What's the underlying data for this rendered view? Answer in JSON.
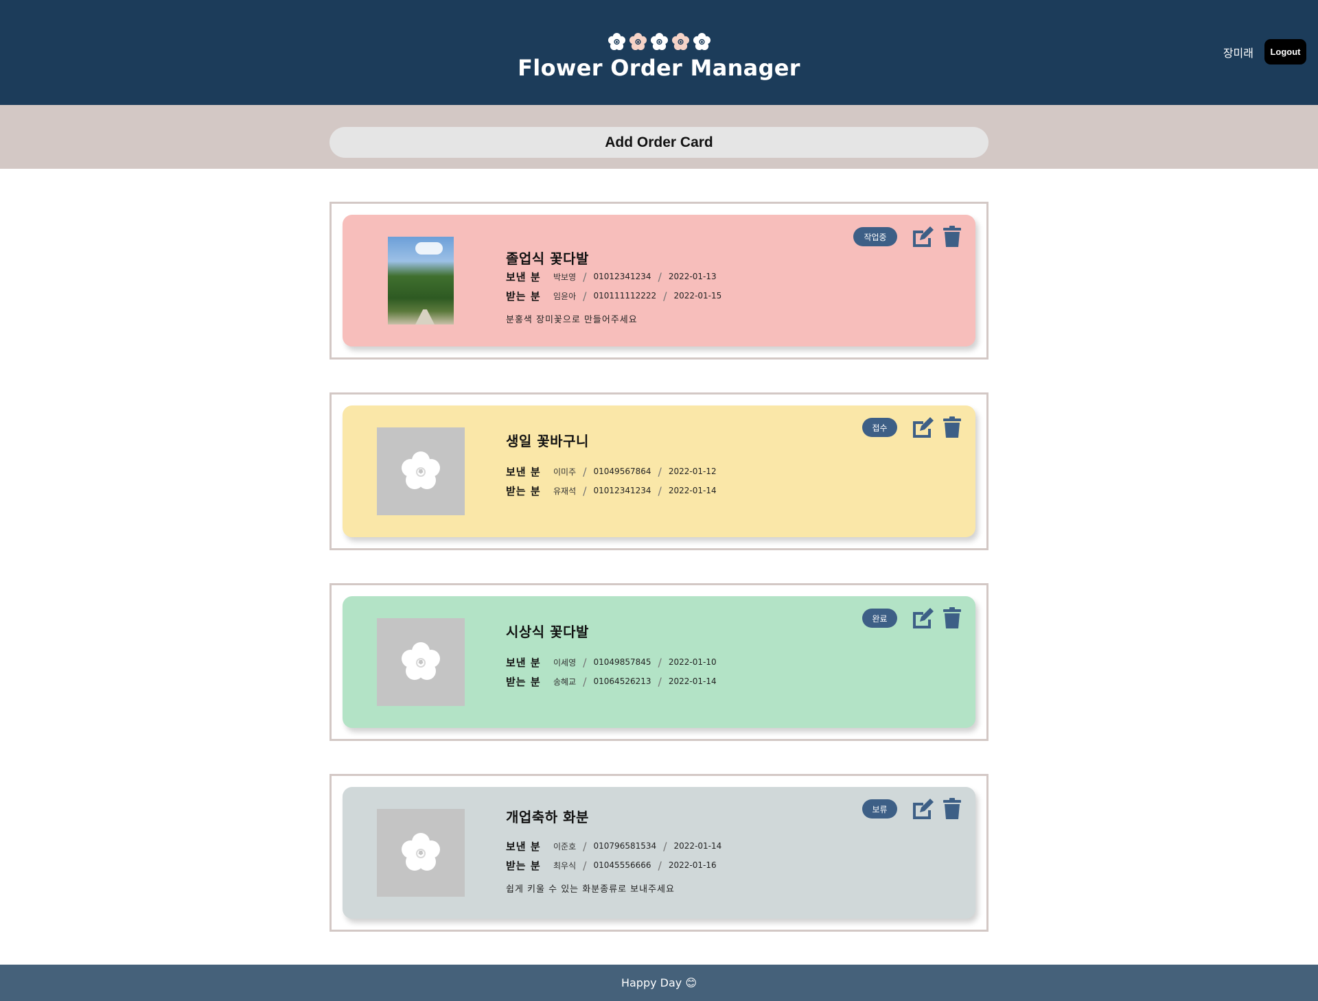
{
  "header": {
    "logo_icons": [
      "flower-icon",
      "flower-icon",
      "flower-icon",
      "flower-icon",
      "flower-icon"
    ],
    "title": "Flower Order Manager",
    "user_name": "장미래",
    "logout_label": "Logout",
    "bg_color": "#1c3c5a"
  },
  "add_card": {
    "label": "Add Order Card"
  },
  "orders": [
    {
      "title": "졸업식 꽃다발",
      "status": "작업중",
      "color": "#f7bebb",
      "image": "photo",
      "sender_label": "보낸 분",
      "sender_name": "박보영",
      "sender_phone": "01012341234",
      "sender_date": "2022-01-13",
      "receiver_label": "받는 분",
      "receiver_name": "임윤아",
      "receiver_phone": "010111112222",
      "receiver_date": "2022-01-15",
      "memo": "분홍색 장미꽃으로 만들어주세요"
    },
    {
      "title": "생일 꽃바구니",
      "status": "접수",
      "color": "#fae7a8",
      "image": "flower-placeholder-icon",
      "sender_label": "보낸 분",
      "sender_name": "이미주",
      "sender_phone": "01049567864",
      "sender_date": "2022-01-12",
      "receiver_label": "받는 분",
      "receiver_name": "유재석",
      "receiver_phone": "01012341234",
      "receiver_date": "2022-01-14",
      "memo": ""
    },
    {
      "title": "시상식 꽃다발",
      "status": "완료",
      "color": "#b3e3c6",
      "image": "flower-placeholder-icon",
      "sender_label": "보낸 분",
      "sender_name": "이세영",
      "sender_phone": "01049857845",
      "sender_date": "2022-01-10",
      "receiver_label": "받는 분",
      "receiver_name": "송혜교",
      "receiver_phone": "01064526213",
      "receiver_date": "2022-01-14",
      "memo": ""
    },
    {
      "title": "개업축하 화분",
      "status": "보류",
      "color": "#d0d8d9",
      "image": "flower-placeholder-icon",
      "sender_label": "보낸 분",
      "sender_name": "이준호",
      "sender_phone": "010796581534",
      "sender_date": "2022-01-14",
      "receiver_label": "받는 분",
      "receiver_name": "최우식",
      "receiver_phone": "01045556666",
      "receiver_date": "2022-01-16",
      "memo": "쉽게 키울 수 있는 화분종류로 보내주세요"
    }
  ],
  "footer": {
    "text": "Happy Day 😊"
  }
}
